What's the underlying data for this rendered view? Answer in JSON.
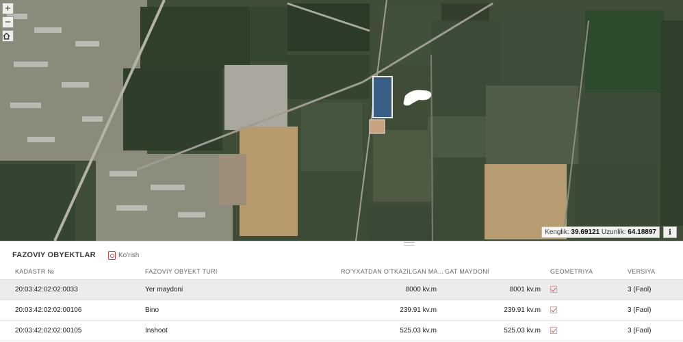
{
  "map": {
    "zoom_in_label": "+",
    "zoom_out_label": "−",
    "home_icon": "home-icon",
    "coords": {
      "lat_label": "Kenglik:",
      "lat_value": "39.69121",
      "lon_label": "Uzunlik:",
      "lon_value": "64.18897"
    },
    "info_label": "i"
  },
  "panel": {
    "title": "FAZOVIY OBYEKTLAR",
    "view_button": {
      "label": "Ko'rish",
      "icon": "view-icon"
    },
    "columns": [
      "KADASTR №",
      "FAZOVIY OBYEKT TURI",
      "RO'YXATDAN O'TKAZILGAN MA...",
      "GAT MAYDONI",
      "GEOMETRIYA",
      "VERSIYA"
    ],
    "rows": [
      {
        "kadastr": "20:03:42:02:02:0033",
        "turi": "Yer maydoni",
        "registered": "8000 kv.m",
        "gat": "8001 kv.m",
        "geometry": true,
        "version": "3 (Faol)",
        "selected": true
      },
      {
        "kadastr": "20:03:42:02:02:00106",
        "turi": "Bino",
        "registered": "239.91 kv.m",
        "gat": "239.91 kv.m",
        "geometry": true,
        "version": "3 (Faol)",
        "selected": false
      },
      {
        "kadastr": "20:03:42:02:02:00105",
        "turi": "Inshoot",
        "registered": "525.03 kv.m",
        "gat": "525.03 kv.m",
        "geometry": true,
        "version": "3 (Faol)",
        "selected": false
      }
    ]
  }
}
